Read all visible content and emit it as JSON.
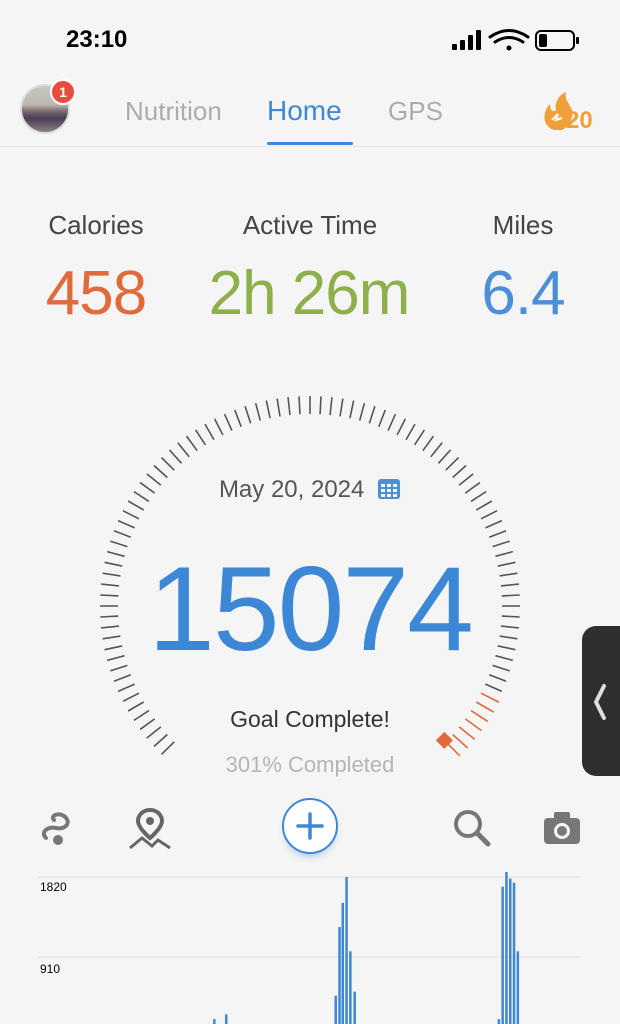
{
  "status_bar": {
    "time": "23:10"
  },
  "header": {
    "avatar_badge": "1",
    "tabs": [
      {
        "label": "Nutrition",
        "active": false
      },
      {
        "label": "Home",
        "active": true
      },
      {
        "label": "GPS",
        "active": false
      }
    ],
    "streak_count": "20"
  },
  "stats": {
    "calories": {
      "label": "Calories",
      "value": "458"
    },
    "active_time": {
      "label": "Active Time",
      "value": "2h 26m"
    },
    "miles": {
      "label": "Miles",
      "value": "6.4"
    }
  },
  "gauge": {
    "date": "May 20, 2024",
    "steps": "15074",
    "goal_text": "Goal Complete!",
    "percent_text": "301% Completed"
  },
  "toolbar": {
    "icons": [
      "route-icon",
      "map-pin-icon",
      "add-icon",
      "search-icon",
      "camera-icon"
    ]
  },
  "colors": {
    "accent_blue": "#3d88d6",
    "calories_orange": "#e06a3a",
    "active_green": "#8db04a",
    "miles_blue": "#4a8fd8",
    "streak_orange": "#f0a03a"
  },
  "chart_data": {
    "type": "bar",
    "yticks": [
      "1820",
      "910"
    ],
    "ylim": [
      0,
      1820
    ],
    "values": [
      0,
      0,
      0,
      0,
      0,
      0,
      0,
      0,
      0,
      0,
      0,
      0,
      0,
      0,
      0,
      0,
      0,
      0,
      0,
      0,
      0,
      0,
      0,
      0,
      0,
      0,
      0,
      0,
      0,
      0,
      0,
      0,
      0,
      0,
      0,
      0,
      0,
      0,
      0,
      0,
      0,
      0,
      0,
      0,
      0,
      0,
      0,
      0,
      0,
      0,
      0,
      0,
      0,
      0,
      0,
      0,
      0,
      0,
      0,
      0,
      0,
      0,
      0,
      0,
      0,
      0,
      0,
      0,
      0,
      0,
      0,
      0,
      0,
      0,
      0,
      0,
      0,
      0,
      0,
      0,
      0,
      0,
      0,
      0,
      0,
      0,
      0,
      0,
      0,
      0,
      0,
      0,
      0,
      0,
      0,
      0,
      0,
      0,
      0,
      0,
      0,
      0,
      0,
      0,
      0,
      0,
      0,
      0,
      0,
      0,
      0,
      0,
      0,
      0,
      0,
      0,
      0,
      0,
      0,
      0,
      0,
      0,
      0,
      0,
      0,
      0,
      0,
      0,
      0,
      0,
      0,
      0,
      0,
      0,
      0,
      0,
      0,
      0,
      0,
      0,
      0,
      0,
      0,
      0,
      0,
      0,
      0,
      0,
      0,
      0,
      0,
      0,
      0,
      0,
      0,
      0,
      0,
      0,
      0,
      0,
      0,
      0,
      0,
      0,
      0,
      0,
      0,
      0,
      0,
      0,
      0,
      0,
      0,
      0,
      0,
      0,
      0,
      0,
      0,
      0,
      0,
      0,
      0,
      0,
      0,
      0,
      0,
      0,
      0,
      0,
      0,
      0,
      0,
      0,
      0,
      0,
      0,
      0,
      0,
      0,
      0,
      0,
      0,
      0,
      0,
      0,
      0,
      0,
      0,
      0,
      0,
      0,
      0,
      0,
      0,
      0,
      0,
      0,
      0,
      0,
      0,
      0,
      0,
      0,
      0,
      0,
      0,
      0,
      0,
      0,
      0,
      0,
      0,
      0,
      0,
      0,
      0,
      0,
      0,
      0,
      0,
      0,
      0,
      0,
      0,
      0,
      0,
      0,
      0,
      0,
      0,
      0,
      0,
      0,
      0,
      0,
      0,
      0,
      0,
      0,
      0,
      0,
      0,
      0,
      0,
      0,
      0,
      0,
      0,
      0,
      0,
      0,
      0,
      0,
      0,
      0,
      0,
      0,
      0,
      0,
      0,
      0,
      0,
      0,
      0,
      0,
      0,
      0,
      0,
      0,
      0,
      0,
      0,
      0,
      0,
      0,
      0,
      0,
      0,
      0,
      0,
      0,
      0,
      0,
      0,
      0,
      0,
      0,
      0,
      0
    ],
    "bars": [
      {
        "x": 0.323,
        "value": 60
      },
      {
        "x": 0.345,
        "value": 120
      },
      {
        "x": 0.56,
        "value": 1500
      },
      {
        "x": 0.567,
        "value": 1820
      },
      {
        "x": 0.574,
        "value": 900
      },
      {
        "x": 0.582,
        "value": 400
      },
      {
        "x": 0.547,
        "value": 350
      },
      {
        "x": 0.554,
        "value": 1200
      },
      {
        "x": 0.855,
        "value": 1700
      },
      {
        "x": 0.862,
        "value": 1900
      },
      {
        "x": 0.869,
        "value": 1800
      },
      {
        "x": 0.876,
        "value": 1750
      },
      {
        "x": 0.883,
        "value": 900
      },
      {
        "x": 0.848,
        "value": 60
      }
    ],
    "xlabel": "",
    "ylabel": ""
  }
}
